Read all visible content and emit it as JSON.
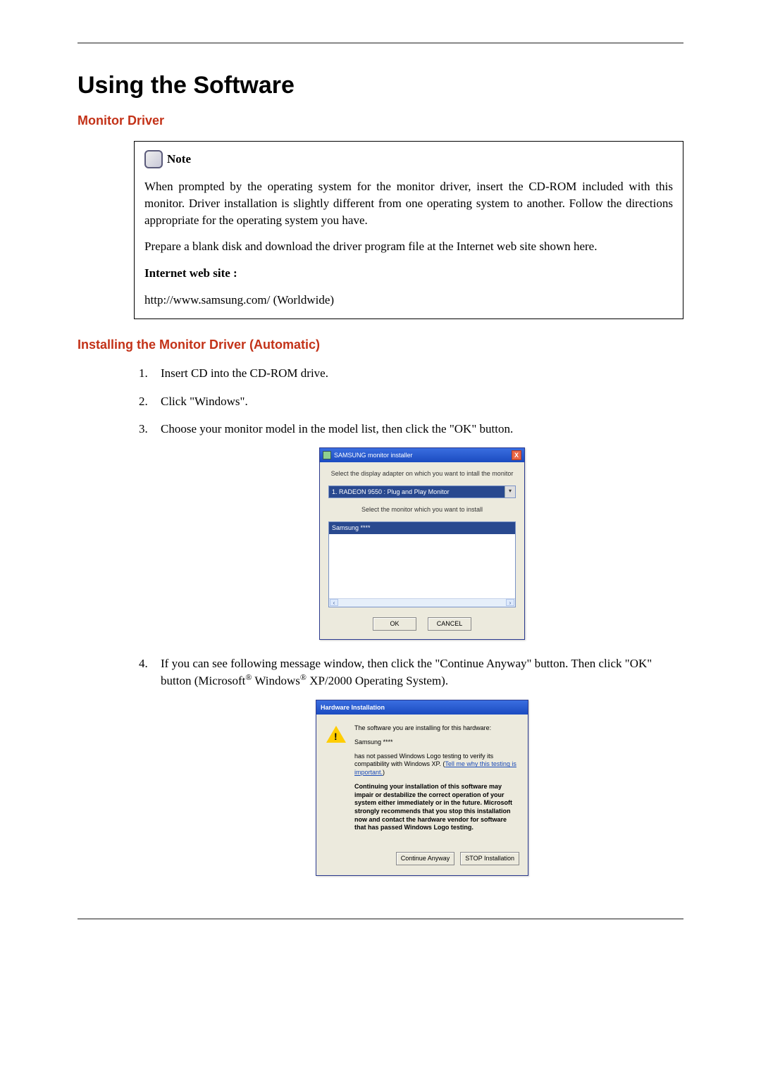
{
  "page": {
    "title": "Using the Software"
  },
  "section1": {
    "heading": "Monitor Driver"
  },
  "note": {
    "label": "Note",
    "para1": "When prompted by the operating system for the monitor driver, insert the CD-ROM included with this monitor. Driver installation is slightly different from one operating system to another. Follow the directions appropriate for the operating system you have.",
    "para2": "Prepare a blank disk and download the driver program file at the Internet web site shown here.",
    "web_label": "Internet web site :",
    "url": "http://www.samsung.com/ (Worldwide)"
  },
  "section2": {
    "heading": "Installing the Monitor Driver (Automatic)"
  },
  "steps": {
    "s1": "Insert CD into the CD-ROM drive.",
    "s2": "Click \"Windows\".",
    "s3": "Choose your monitor model in the model list, then click the \"OK\" button.",
    "s4_a": "If you can see following message window, then click the \"Continue Anyway\" button. Then click \"OK\" button (Microsoft",
    "s4_b": " Windows",
    "s4_c": " XP/2000 Operating System).",
    "reg": "®"
  },
  "samsung": {
    "title": "SAMSUNG monitor installer",
    "close": "X",
    "instr1": "Select the display adapter on which you want to intall the monitor",
    "adapter": "1. RADEON 9550 : Plug and Play Monitor",
    "instr2": "Select the monitor which you want to install",
    "item": "Samsung ****",
    "scroll_left": "‹",
    "scroll_right": "›",
    "dd": "▾",
    "ok": "OK",
    "cancel": "CANCEL"
  },
  "hw": {
    "title": "Hardware Installation",
    "bang": "!",
    "line1": "The software you are installing for this hardware:",
    "line2": "Samsung ****",
    "line3a": "has not passed Windows Logo testing to verify its compatibility with Windows XP. (",
    "link": "Tell me why this testing is important.",
    "line3b": ")",
    "bold": "Continuing your installation of this software may impair or destabilize the correct operation of your system either immediately or in the future. Microsoft strongly recommends that you stop this installation now and contact the hardware vendor for software that has passed Windows Logo testing.",
    "continue": "Continue Anyway",
    "stop": "STOP Installation"
  }
}
